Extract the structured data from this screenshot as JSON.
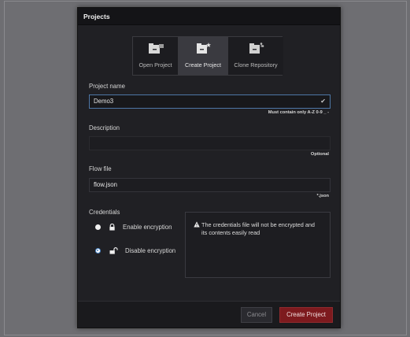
{
  "dialog": {
    "title": "Projects"
  },
  "tabs": [
    {
      "label": "Open Project",
      "icon": "folder-open-icon"
    },
    {
      "label": "Create Project",
      "icon": "folder-plus-icon"
    },
    {
      "label": "Clone Repository",
      "icon": "folder-git-icon"
    }
  ],
  "active_tab": "Create Project",
  "form": {
    "project_name": {
      "label": "Project name",
      "value": "Demo3",
      "hint": "Must contain only A-Z 0-9 _ -"
    },
    "description": {
      "label": "Description",
      "value": "",
      "hint": "Optional"
    },
    "flow_file": {
      "label": "Flow file",
      "value": "flow.json",
      "hint": "*.json"
    },
    "credentials": {
      "label": "Credentials",
      "options": [
        {
          "label": "Enable encryption",
          "selected": false
        },
        {
          "label": "Disable encryption",
          "selected": true
        }
      ],
      "warning": "The credentials file will not be encrypted and its contents easily read"
    }
  },
  "footer": {
    "cancel_label": "Cancel",
    "create_label": "Create Project"
  },
  "colors": {
    "accent": "#4a84c4",
    "primary_button": "#7d1a1e",
    "dialog_bg": "#202024"
  }
}
